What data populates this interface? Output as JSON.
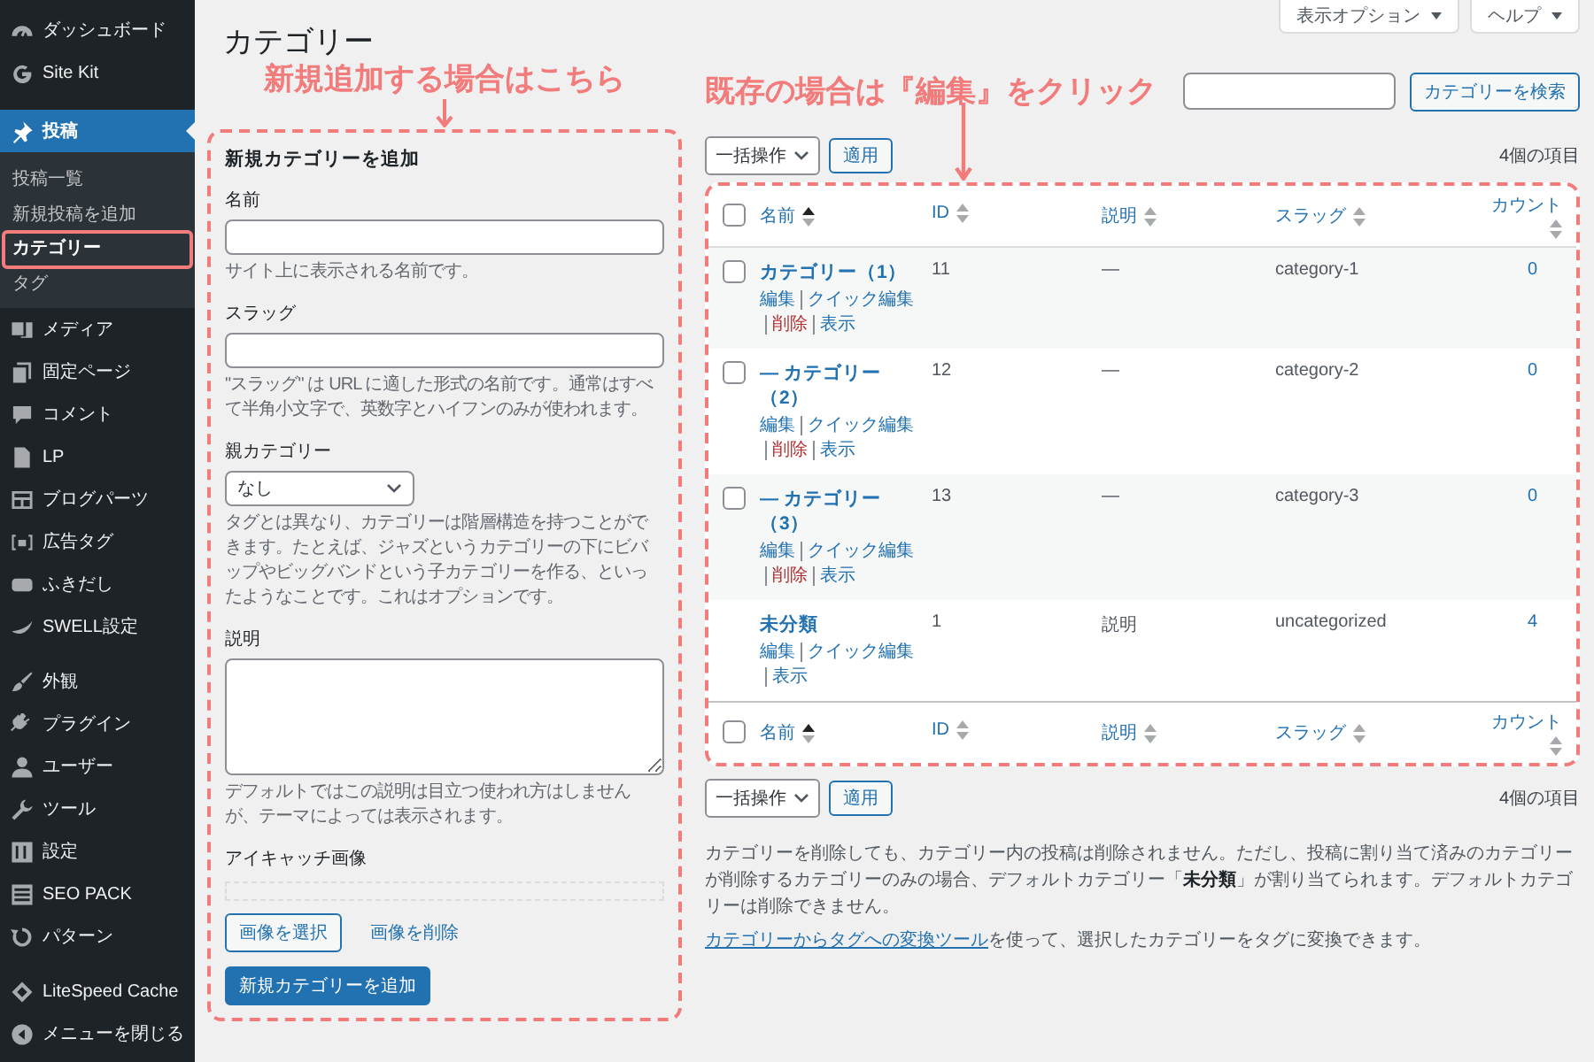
{
  "sidebar": {
    "groups": [
      {
        "items": [
          {
            "label": "ダッシュボード",
            "selected": false
          },
          {
            "label": "Site Kit",
            "selected": false
          }
        ]
      },
      {
        "items": [
          {
            "label": "投稿",
            "selected": true,
            "children": [
              {
                "label": "投稿一覧",
                "selected": false,
                "highlighted": false
              },
              {
                "label": "新規投稿を追加",
                "selected": false,
                "highlighted": false
              },
              {
                "label": "カテゴリー",
                "selected": true,
                "highlighted": true
              },
              {
                "label": "タグ",
                "selected": false,
                "highlighted": false
              }
            ]
          },
          {
            "label": "メディア",
            "selected": false
          },
          {
            "label": "固定ページ",
            "selected": false
          },
          {
            "label": "コメント",
            "selected": false
          },
          {
            "label": "LP",
            "selected": false
          },
          {
            "label": "ブログパーツ",
            "selected": false
          },
          {
            "label": "広告タグ",
            "selected": false
          },
          {
            "label": "ふきだし",
            "selected": false
          },
          {
            "label": "SWELL設定",
            "selected": false
          }
        ]
      },
      {
        "items": [
          {
            "label": "外観",
            "selected": false
          },
          {
            "label": "プラグイン",
            "selected": false
          },
          {
            "label": "ユーザー",
            "selected": false
          },
          {
            "label": "ツール",
            "selected": false
          },
          {
            "label": "設定",
            "selected": false
          },
          {
            "label": "SEO PACK",
            "selected": false
          },
          {
            "label": "パターン",
            "selected": false
          }
        ]
      },
      {
        "items": [
          {
            "label": "LiteSpeed Cache",
            "selected": false
          },
          {
            "label": "メニューを閉じる",
            "selected": false
          }
        ]
      }
    ]
  },
  "page": {
    "title": "カテゴリー",
    "screen_meta": [
      {
        "label": "表示オプション"
      },
      {
        "label": "ヘルプ"
      }
    ]
  },
  "add_form": {
    "annotation": "新規追加する場合はこちら",
    "heading": "新規カテゴリーを追加",
    "fields": [
      {
        "kind": "text",
        "label": "名前",
        "help": "サイト上に表示される名前です。"
      },
      {
        "kind": "text",
        "label": "スラッグ",
        "help": "\"スラッグ\" は URL に適した形式の名前です。通常はすべて半角小文字で、英数字とハイフンのみが使われます。"
      },
      {
        "kind": "select",
        "label": "親カテゴリー",
        "value": "なし",
        "help": "タグとは異なり、カテゴリーは階層構造を持つことができます。たとえば、ジャズというカテゴリーの下にビバップやビッグバンドという子カテゴリーを作る、といったようなことです。これはオプションです。"
      },
      {
        "kind": "textarea",
        "label": "説明",
        "help": "デフォルトではこの説明は目立つ使われ方はしませんが、テーマによっては表示されます。"
      },
      {
        "kind": "image",
        "label": "アイキャッチ画像",
        "select_button": "画像を選択",
        "remove_link": "画像を削除"
      }
    ],
    "submit": "新規カテゴリーを追加"
  },
  "list": {
    "annotation": "既存の場合は『編集』をクリック",
    "search_button": "カテゴリーを検索",
    "bulk_top": {
      "value": "一括操作",
      "apply": "適用",
      "count": "4個の項目"
    },
    "table": {
      "select_all_checked": false,
      "columns": [
        {
          "label": "名前",
          "sorted": true
        },
        {
          "label": "ID",
          "sorted": false
        },
        {
          "label": "説明",
          "sorted": false
        },
        {
          "label": "スラッグ",
          "sorted": false
        },
        {
          "label": "カウント",
          "sorted": false
        }
      ],
      "rows": [
        {
          "name": "カテゴリー（1）",
          "id": "11",
          "description": "—",
          "slug": "category-1",
          "count": "0",
          "kind": "standard",
          "checked": false,
          "actions": [
            {
              "kind": "edit",
              "label": "編集"
            },
            {
              "kind": "quick_edit",
              "label": "クイック編集"
            },
            {
              "kind": "delete",
              "label": "削除"
            },
            {
              "kind": "view",
              "label": "表示"
            }
          ]
        },
        {
          "name": "— カテゴリー（2）",
          "id": "12",
          "description": "—",
          "slug": "category-2",
          "count": "0",
          "kind": "standard",
          "checked": false,
          "actions": [
            {
              "kind": "edit",
              "label": "編集"
            },
            {
              "kind": "quick_edit",
              "label": "クイック編集"
            },
            {
              "kind": "delete",
              "label": "削除"
            },
            {
              "kind": "view",
              "label": "表示"
            }
          ]
        },
        {
          "name": "— カテゴリー（3）",
          "id": "13",
          "description": "—",
          "slug": "category-3",
          "count": "0",
          "kind": "standard",
          "checked": false,
          "actions": [
            {
              "kind": "edit",
              "label": "編集"
            },
            {
              "kind": "quick_edit",
              "label": "クイック編集"
            },
            {
              "kind": "delete",
              "label": "削除"
            },
            {
              "kind": "view",
              "label": "表示"
            }
          ]
        },
        {
          "name": "未分類",
          "id": "1",
          "description": "説明",
          "slug": "uncategorized",
          "count": "4",
          "kind": "default",
          "actions": [
            {
              "kind": "edit",
              "label": "編集"
            },
            {
              "kind": "quick_edit",
              "label": "クイック編集"
            },
            {
              "kind": "view",
              "label": "表示"
            }
          ]
        }
      ],
      "footer_select_all_checked": false,
      "footer_columns": [
        {
          "label": "名前",
          "sorted": true
        },
        {
          "label": "ID",
          "sorted": false
        },
        {
          "label": "説明",
          "sorted": false
        },
        {
          "label": "スラッグ",
          "sorted": false
        },
        {
          "label": "カウント",
          "sorted": false
        }
      ]
    },
    "bulk_bottom": {
      "value": "一括操作",
      "apply": "適用",
      "count": "4個の項目"
    },
    "notes": [
      {
        "kind": "text",
        "text": "カテゴリーを削除しても、カテゴリー内の投稿は削除されません。ただし、投稿に割り当て済みのカテゴリーが削除するカテゴリーのみの場合、デフォルトカテゴリー「**未分類**」が割り当てられます。デフォルトカテゴリーは削除できません。"
      },
      {
        "kind": "link_text",
        "link": "カテゴリーからタグへの変換ツール",
        "text": "を使って、選択したカテゴリーをタグに変換できます。"
      }
    ]
  }
}
